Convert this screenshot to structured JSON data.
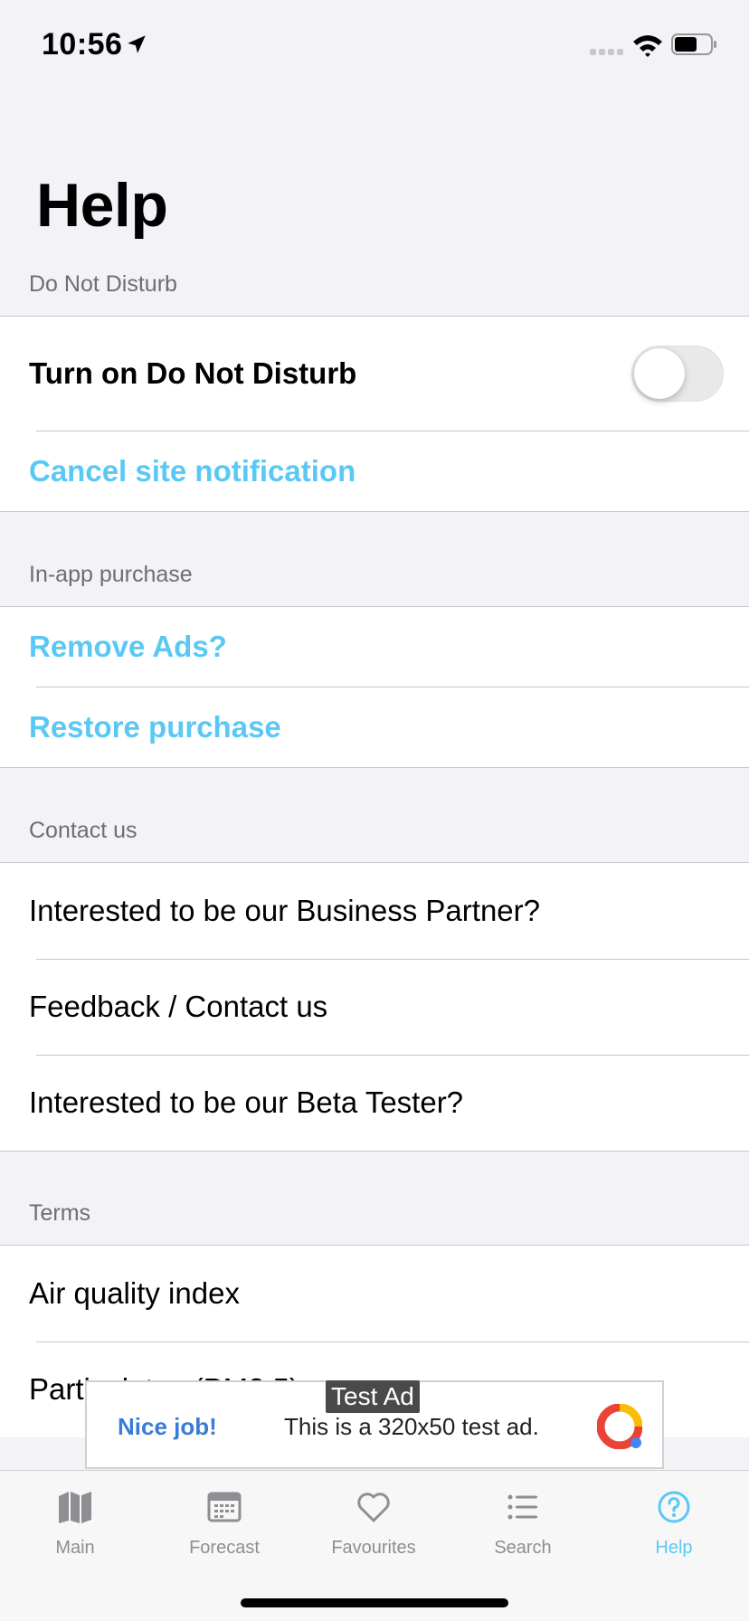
{
  "status_bar": {
    "time": "10:56"
  },
  "page_title": "Help",
  "sections": {
    "dnd": {
      "header": "Do Not Disturb",
      "toggle_label": "Turn on Do Not Disturb",
      "toggle_on": false,
      "cancel_label": "Cancel site notification"
    },
    "iap": {
      "header": "In-app purchase",
      "remove_ads": "Remove Ads?",
      "restore": "Restore purchase"
    },
    "contact": {
      "header": "Contact us",
      "items": [
        "Interested to be our Business Partner?",
        "Feedback / Contact us",
        "Interested to be our Beta Tester?"
      ]
    },
    "terms": {
      "header": "Terms",
      "items": [
        "Air quality index",
        "Particulates (PM2.5)"
      ]
    }
  },
  "ad": {
    "tag": "Test Ad",
    "nice": "Nice job!",
    "text": "This is a 320x50 test ad."
  },
  "tabs": [
    {
      "label": "Main",
      "icon": "map-icon"
    },
    {
      "label": "Forecast",
      "icon": "calendar-icon"
    },
    {
      "label": "Favourites",
      "icon": "heart-icon"
    },
    {
      "label": "Search",
      "icon": "list-icon"
    },
    {
      "label": "Help",
      "icon": "question-icon",
      "active": true
    }
  ],
  "colors": {
    "accent": "#5ac8f5",
    "background": "#f2f2f7",
    "ad_link": "#3a7bd5"
  }
}
